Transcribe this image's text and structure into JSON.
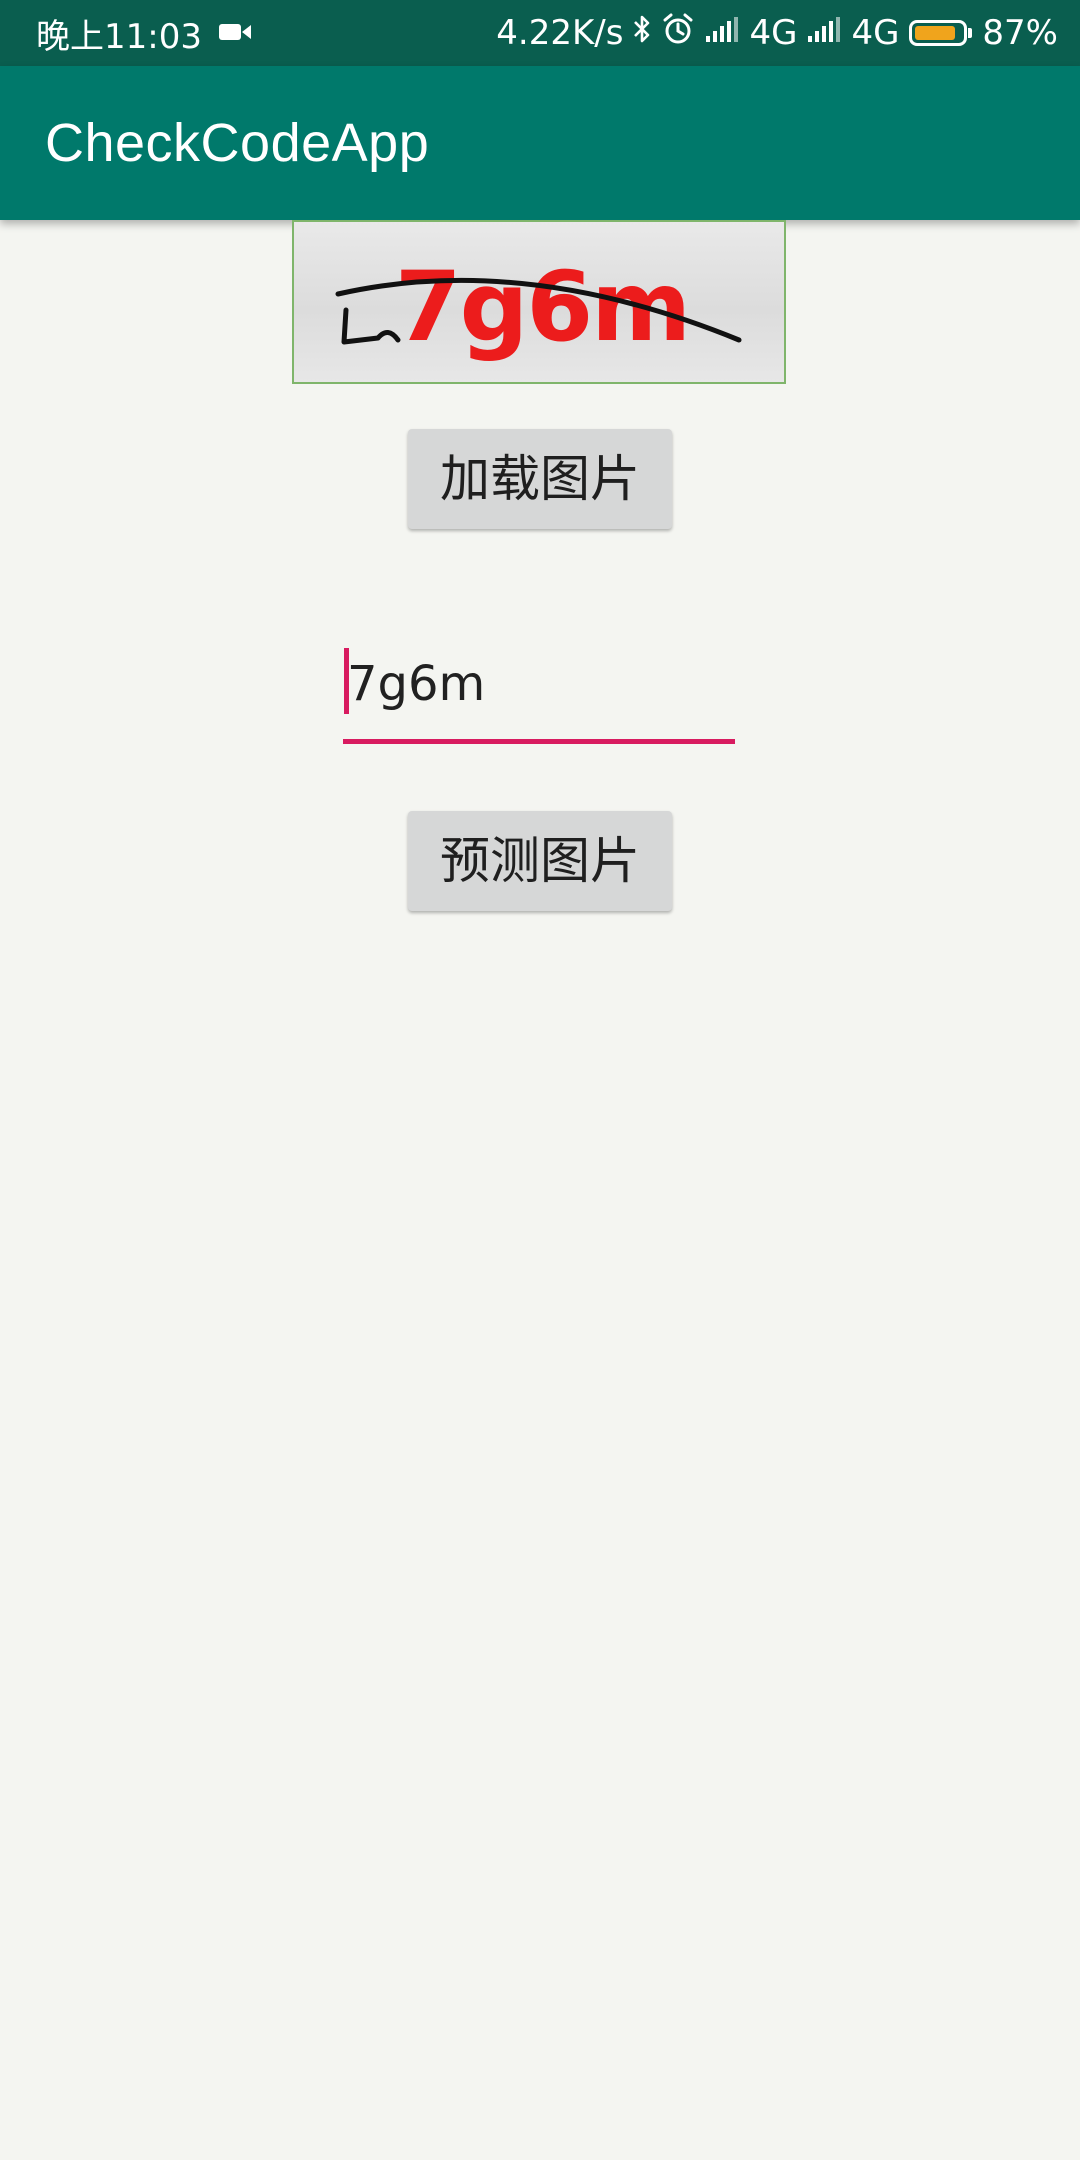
{
  "status_bar": {
    "time": "晚上11:03",
    "speed": "4.22K/s",
    "network_1": "4G",
    "network_2": "4G",
    "battery": "87%",
    "battery_level": 0.87,
    "battery_color": "#f0a41c",
    "icons": [
      "video-camera-icon",
      "bluetooth-icon",
      "alarm-clock-icon",
      "signal-icon",
      "signal-icon",
      "battery-icon"
    ]
  },
  "app_bar": {
    "title": "CheckCodeApp",
    "color": "#00796b"
  },
  "captcha": {
    "text": "7g6m"
  },
  "buttons": {
    "load_label": "加载图片",
    "predict_label": "预测图片"
  },
  "code_input": {
    "value": "7g6m",
    "accent_color": "#d81b60"
  }
}
